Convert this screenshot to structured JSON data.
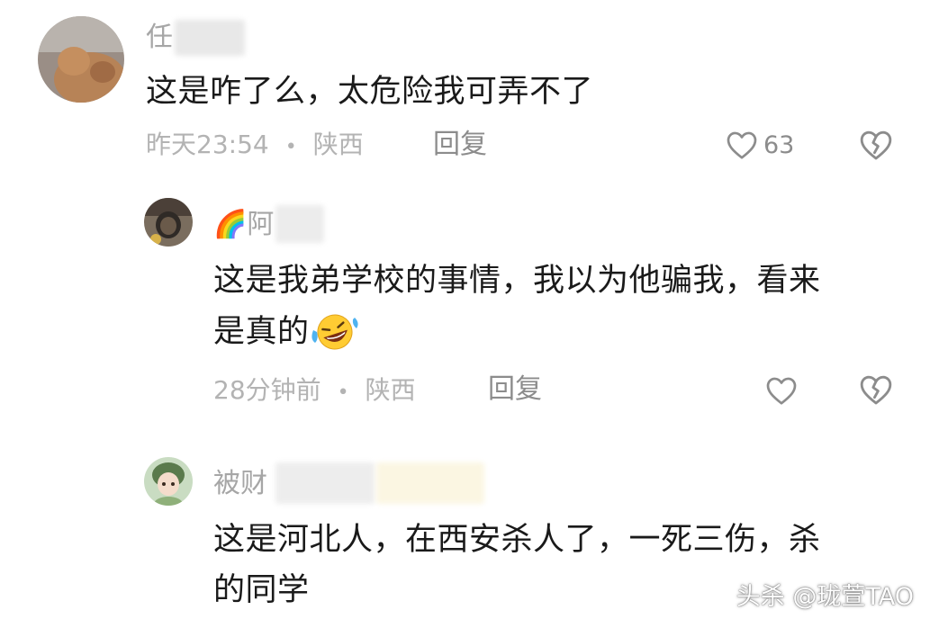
{
  "comments": [
    {
      "username": "任",
      "text": "这是咋了么，太危险我可弄不了",
      "time": "昨天23:54",
      "separator": "•",
      "location": "陕西",
      "reply_label": "回复",
      "like_count": "63"
    },
    {
      "username": "阿",
      "badge_emoji": "🌈",
      "text_line1": "这是我弟学校的事情，我以为他骗我，看来",
      "text_line2": "是真的",
      "time": "28分钟前",
      "separator": "•",
      "location": "陕西",
      "reply_label": "回复"
    },
    {
      "username": "被财",
      "text_line1": "这是河北人，在西安杀人了，一死三伤，杀",
      "text_line2": "的同学"
    }
  ],
  "watermark": "头杀 @珑萱TAO",
  "icons": {
    "like": "heart-outline-icon",
    "dislike": "broken-heart-icon"
  },
  "colors": {
    "text": "#1a1a1a",
    "meta": "#b3b3b3",
    "icon": "#8c8c8c"
  }
}
